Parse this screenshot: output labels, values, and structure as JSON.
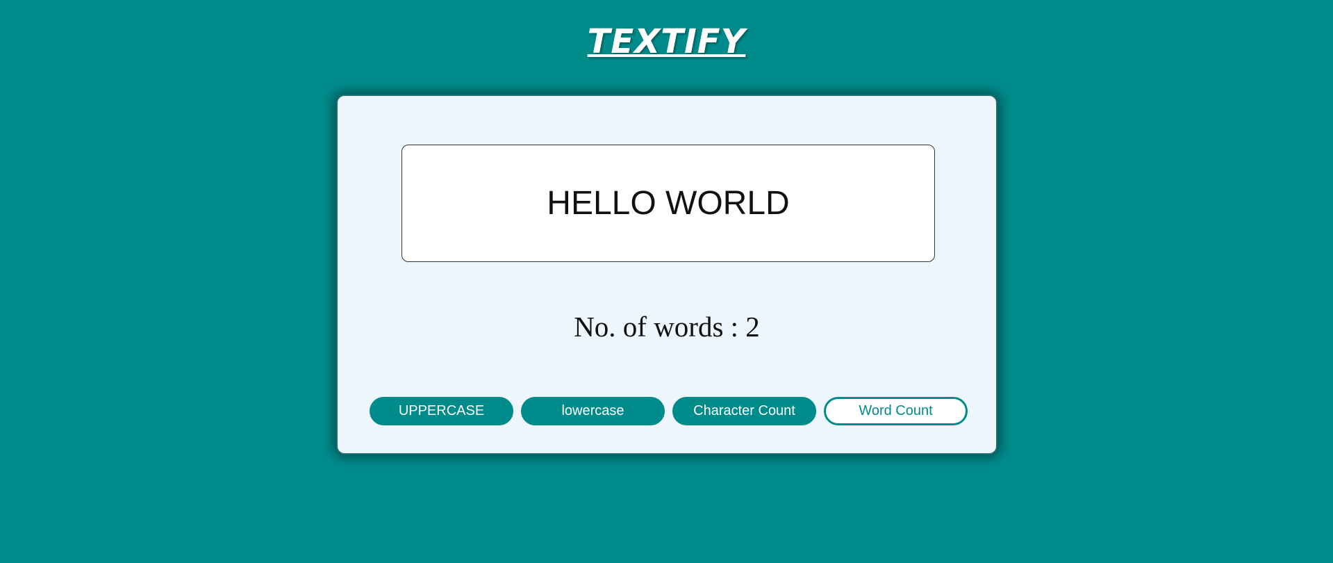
{
  "app": {
    "title": "TEXTIFY"
  },
  "editor": {
    "text": "HELLO WORLD"
  },
  "result": {
    "text": "No. of words : 2"
  },
  "buttons": {
    "uppercase": "UPPERCASE",
    "lowercase": "lowercase",
    "character_count": "Character Count",
    "word_count": "Word Count"
  },
  "colors": {
    "background": "#008b8b",
    "card": "#eef6fd",
    "accent": "#008b8b"
  }
}
